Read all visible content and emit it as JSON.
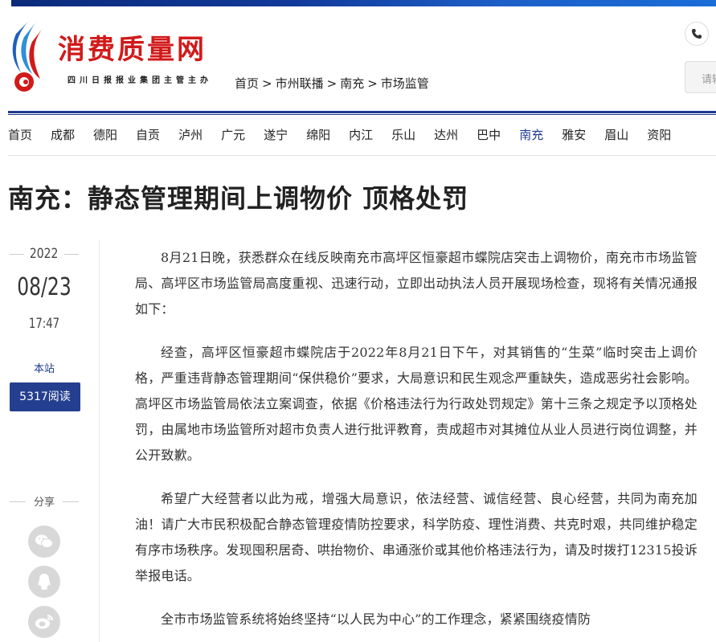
{
  "brand": {
    "name": "消费质量网",
    "subtitle": "四川日报报业集团主管主办"
  },
  "breadcrumb": [
    "首页",
    "市州联播",
    "南充",
    "市场监管"
  ],
  "breadcrumb_sep": ">",
  "search": {
    "placeholder": "请输入"
  },
  "nav": {
    "items": [
      "首页",
      "成都",
      "德阳",
      "自贡",
      "泸州",
      "广元",
      "遂宁",
      "绵阳",
      "内江",
      "乐山",
      "达州",
      "巴中",
      "南充",
      "雅安",
      "眉山",
      "资阳"
    ],
    "active": "南充"
  },
  "article": {
    "title": "南充：静态管理期间上调物价 顶格处罚",
    "year": "2022",
    "date": "08/23",
    "time": "17:47",
    "source": "本站",
    "reads": "5317阅读",
    "share_label": "分享",
    "paragraphs": [
      "8月21日晚，获悉群众在线反映南充市高坪区恒豪超市蝶院店突击上调物价，南充市市场监管局、高坪区市场监管局高度重视、迅速行动，立即出动执法人员开展现场检查，现将有关情况通报如下：",
      "经查，高坪区恒豪超市蝶院店于2022年8月21日下午，对其销售的“生菜”临时突击上调价格，严重违背静态管理期间“保供稳价”要求，大局意识和民生观念严重缺失，造成恶劣社会影响。高坪区市场监管局依法立案调查，依据《价格违法行为行政处罚规定》第十三条之规定予以顶格处罚，由属地市场监管所对超市负责人进行批评教育，责成超市对其摊位从业人员进行岗位调整，并公开致歉。",
      "希望广大经营者以此为戒，增强大局意识，依法经营、诚信经营、良心经营，共同为南充加油！请广大市民积极配合静态管理疫情防控要求，科学防疫、理性消费、共克时艰，共同维护稳定有序市场秩序。发现囤积居奇、哄抬物价、串通涨价或其他价格违法行为，请及时拨打12315投诉举报电话。",
      "全市市场监管系统将始终坚持“以人民为中心”的工作理念，紧紧围绕疫情防"
    ]
  },
  "colors": {
    "brand_red": "#d11a1a",
    "nav_blue": "#1f3a8f",
    "reads_bg": "#243f8f"
  },
  "icons": [
    "phone-icon",
    "wechat-icon",
    "qq-icon",
    "weibo-icon"
  ]
}
